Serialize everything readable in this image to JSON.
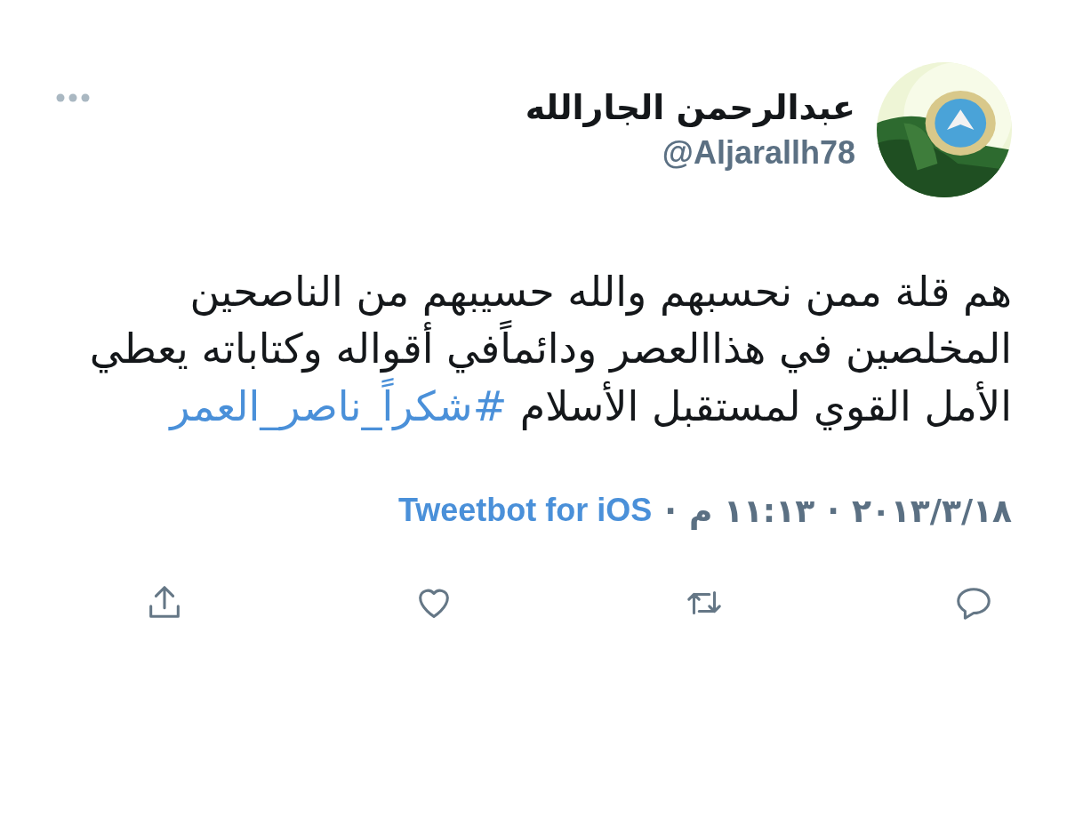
{
  "author": {
    "name": "عبدالرحمن الجارالله",
    "handle": "@Aljarallh78"
  },
  "tweet": {
    "text": "هم قلة ممن نحسبهم والله حسيبهم من الناصحين المخلصين في هذاالعصر ودائماًفي أقواله وكتاباته يعطي الأمل القوي لمستقبل الأسلام",
    "hashtag": "#شكراً_ناصر_العمر"
  },
  "meta": [
    {
      "kind": "text",
      "text": "٢٠١٣/٣/١٨"
    },
    {
      "kind": "separator",
      "text": "·"
    },
    {
      "kind": "text",
      "text": "١١:١٣ م"
    },
    {
      "kind": "separator",
      "text": "·"
    },
    {
      "kind": "link",
      "text": "Tweetbot for iOS"
    }
  ]
}
